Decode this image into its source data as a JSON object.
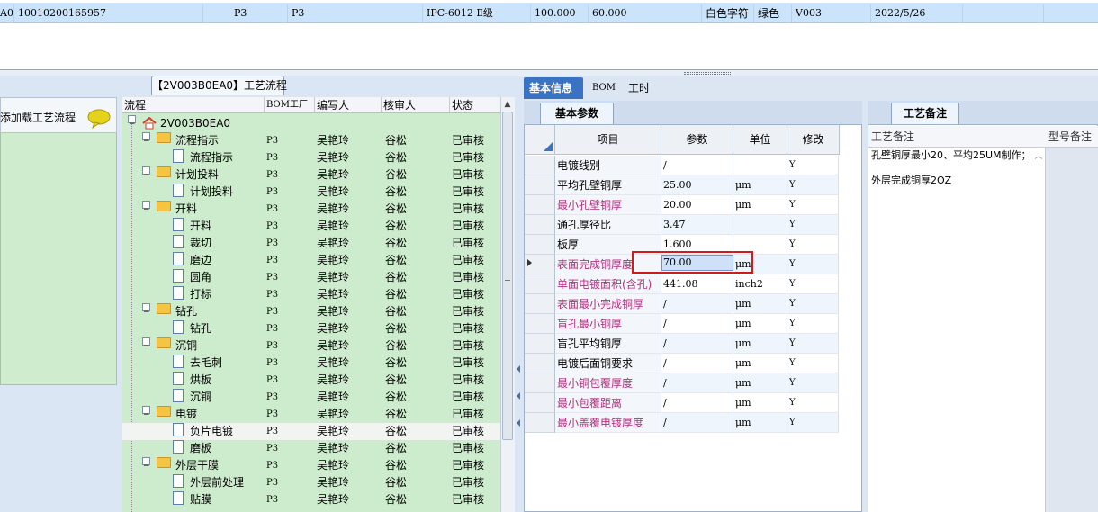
{
  "top_row": {
    "cells": [
      "A0",
      "10010200165957",
      "P3",
      "P3",
      "IPC-6012 Ⅱ级",
      "100.000",
      "60.000",
      "白色字符",
      "绿色",
      "V003",
      "2022/5/26"
    ]
  },
  "flow_title": "【2V003B0EA0】工艺流程",
  "side_panel": {
    "label": "添加载工艺流程"
  },
  "tree": {
    "headers": [
      "流程",
      "BOM工厂",
      "编写人",
      "核审人",
      "状态"
    ],
    "rows": [
      {
        "name": "2V003B0EA0",
        "factory": "",
        "author": "",
        "reviewer": "",
        "status": "",
        "level": 0,
        "kind": "home"
      },
      {
        "name": "流程指示",
        "factory": "P3",
        "author": "吴艳玲",
        "reviewer": "谷松",
        "status": "已审核",
        "level": 1,
        "kind": "folder"
      },
      {
        "name": "流程指示",
        "factory": "P3",
        "author": "吴艳玲",
        "reviewer": "谷松",
        "status": "已审核",
        "level": 2,
        "kind": "doc"
      },
      {
        "name": "计划投料",
        "factory": "P3",
        "author": "吴艳玲",
        "reviewer": "谷松",
        "status": "已审核",
        "level": 1,
        "kind": "folder"
      },
      {
        "name": "计划投料",
        "factory": "P3",
        "author": "吴艳玲",
        "reviewer": "谷松",
        "status": "已审核",
        "level": 2,
        "kind": "doc"
      },
      {
        "name": "开料",
        "factory": "P3",
        "author": "吴艳玲",
        "reviewer": "谷松",
        "status": "已审核",
        "level": 1,
        "kind": "folder"
      },
      {
        "name": "开料",
        "factory": "P3",
        "author": "吴艳玲",
        "reviewer": "谷松",
        "status": "已审核",
        "level": 2,
        "kind": "doc"
      },
      {
        "name": "裁切",
        "factory": "P3",
        "author": "吴艳玲",
        "reviewer": "谷松",
        "status": "已审核",
        "level": 2,
        "kind": "doc"
      },
      {
        "name": "磨边",
        "factory": "P3",
        "author": "吴艳玲",
        "reviewer": "谷松",
        "status": "已审核",
        "level": 2,
        "kind": "doc"
      },
      {
        "name": "圆角",
        "factory": "P3",
        "author": "吴艳玲",
        "reviewer": "谷松",
        "status": "已审核",
        "level": 2,
        "kind": "doc"
      },
      {
        "name": "打标",
        "factory": "P3",
        "author": "吴艳玲",
        "reviewer": "谷松",
        "status": "已审核",
        "level": 2,
        "kind": "doc"
      },
      {
        "name": "钻孔",
        "factory": "P3",
        "author": "吴艳玲",
        "reviewer": "谷松",
        "status": "已审核",
        "level": 1,
        "kind": "folder"
      },
      {
        "name": "钻孔",
        "factory": "P3",
        "author": "吴艳玲",
        "reviewer": "谷松",
        "status": "已审核",
        "level": 2,
        "kind": "doc"
      },
      {
        "name": "沉铜",
        "factory": "P3",
        "author": "吴艳玲",
        "reviewer": "谷松",
        "status": "已审核",
        "level": 1,
        "kind": "folder"
      },
      {
        "name": "去毛刺",
        "factory": "P3",
        "author": "吴艳玲",
        "reviewer": "谷松",
        "status": "已审核",
        "level": 2,
        "kind": "doc"
      },
      {
        "name": "烘板",
        "factory": "P3",
        "author": "吴艳玲",
        "reviewer": "谷松",
        "status": "已审核",
        "level": 2,
        "kind": "doc"
      },
      {
        "name": "沉铜",
        "factory": "P3",
        "author": "吴艳玲",
        "reviewer": "谷松",
        "status": "已审核",
        "level": 2,
        "kind": "doc"
      },
      {
        "name": "电镀",
        "factory": "P3",
        "author": "吴艳玲",
        "reviewer": "谷松",
        "status": "已审核",
        "level": 1,
        "kind": "folder"
      },
      {
        "name": "负片电镀",
        "factory": "P3",
        "author": "吴艳玲",
        "reviewer": "谷松",
        "status": "已审核",
        "level": 2,
        "kind": "doc",
        "selected": true
      },
      {
        "name": "磨板",
        "factory": "P3",
        "author": "吴艳玲",
        "reviewer": "谷松",
        "status": "已审核",
        "level": 2,
        "kind": "doc"
      },
      {
        "name": "外层干膜",
        "factory": "P3",
        "author": "吴艳玲",
        "reviewer": "谷松",
        "status": "已审核",
        "level": 1,
        "kind": "folder"
      },
      {
        "name": "外层前处理",
        "factory": "P3",
        "author": "吴艳玲",
        "reviewer": "谷松",
        "status": "已审核",
        "level": 2,
        "kind": "doc"
      },
      {
        "name": "贴膜",
        "factory": "P3",
        "author": "吴艳玲",
        "reviewer": "谷松",
        "status": "已审核",
        "level": 2,
        "kind": "doc"
      }
    ]
  },
  "right_tabs": [
    "基本信息",
    "BOM",
    "工时"
  ],
  "params": {
    "tab_label": "基本参数",
    "headers": [
      "项目",
      "参数",
      "单位",
      "修改"
    ],
    "rows": [
      {
        "item": "电镀线别",
        "value": "/",
        "unit": "",
        "mod": "Y",
        "pink": false
      },
      {
        "item": "平均孔壁铜厚",
        "value": "25.00",
        "unit": "μm",
        "mod": "Y",
        "pink": false
      },
      {
        "item": "最小孔壁铜厚",
        "value": "20.00",
        "unit": "μm",
        "mod": "Y",
        "pink": true
      },
      {
        "item": "通孔厚径比",
        "value": "3.47",
        "unit": "",
        "mod": "Y",
        "pink": false
      },
      {
        "item": "板厚",
        "value": "1.600",
        "unit": "",
        "mod": "Y",
        "pink": false
      },
      {
        "item": "表面完成铜厚度",
        "value": "70.00",
        "unit": "μm",
        "mod": "Y",
        "pink": true
      },
      {
        "item": "单面电镀面积(含孔)",
        "value": "441.08",
        "unit": "inch2",
        "mod": "Y",
        "pink": true
      },
      {
        "item": "表面最小完成铜厚",
        "value": "/",
        "unit": "μm",
        "mod": "Y",
        "pink": true
      },
      {
        "item": "盲孔最小铜厚",
        "value": "/",
        "unit": "μm",
        "mod": "Y",
        "pink": true
      },
      {
        "item": "盲孔平均铜厚",
        "value": "/",
        "unit": "μm",
        "mod": "Y",
        "pink": false
      },
      {
        "item": "电镀后面铜要求",
        "value": "/",
        "unit": "μm",
        "mod": "Y",
        "pink": false
      },
      {
        "item": "最小铜包覆厚度",
        "value": "/",
        "unit": "μm",
        "mod": "Y",
        "pink": true
      },
      {
        "item": "最小包覆距离",
        "value": "/",
        "unit": "μm",
        "mod": "Y",
        "pink": true
      },
      {
        "item": "最小盖覆电镀厚度",
        "value": "/",
        "unit": "μm",
        "mod": "Y",
        "pink": true
      }
    ]
  },
  "remarks": {
    "tab_label": "工艺备注",
    "col_note": "工艺备注",
    "col_model": "型号备注",
    "note_line1": "孔壁铜厚最小20、平均25UM制作；",
    "note_line2": "外层完成铜厚2OZ"
  },
  "colors": {
    "accent": "#3a73c1",
    "tree_bg": "#cdeccd",
    "pink": "#b0307e",
    "highlight": "#d01b1b"
  }
}
